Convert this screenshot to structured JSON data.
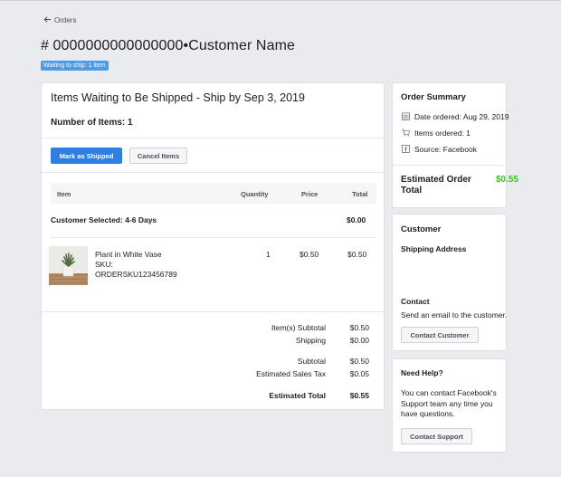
{
  "nav": {
    "back_label": "Orders"
  },
  "header": {
    "title": "# 0000000000000000•Customer Name",
    "status_badge": "Waiting to ship: 1 item"
  },
  "main": {
    "heading": "Items Waiting to Be Shipped - Ship by Sep 3, 2019",
    "items_count_label": "Number of Items: 1",
    "mark_shipped_label": "Mark as Shipped",
    "cancel_items_label": "Cancel Items",
    "table": {
      "columns": {
        "item": "Item",
        "quantity": "Quantity",
        "price": "Price",
        "total": "Total"
      },
      "group": {
        "label": "Customer Selected:  4-6 Days",
        "total": "$0.00"
      },
      "rows": [
        {
          "name": "Plant in White Vase",
          "sku_label": "SKU:",
          "sku": "ORDERSKU123456789",
          "quantity": "1",
          "price": "$0.50",
          "total": "$0.50"
        }
      ]
    },
    "totals": {
      "items_subtotal_label": "Item(s) Subtotal",
      "items_subtotal": "$0.50",
      "shipping_label": "Shipping",
      "shipping": "$0.00",
      "subtotal_label": "Subtotal",
      "subtotal": "$0.50",
      "tax_label": "Estimated Sales Tax",
      "tax": "$0.05",
      "total_label": "Estimated Total",
      "total": "$0.55"
    }
  },
  "summary": {
    "title": "Order Summary",
    "date_ordered": "Date ordered: Aug 29, 2019",
    "items_ordered": "Items ordered: 1",
    "source": "Source: Facebook",
    "estimated_total_label": "Estimated Order Total",
    "estimated_total": "$0.55"
  },
  "customer": {
    "title": "Customer",
    "shipping_address_label": "Shipping Address",
    "contact_label": "Contact",
    "contact_text": "Send an email to the customer.",
    "contact_button": "Contact Customer"
  },
  "help": {
    "title": "Need Help?",
    "text": "You can contact Facebook's Support team any time you have questions.",
    "button": "Contact Support"
  },
  "colors": {
    "accent": "#2e7ee6",
    "badge": "#4b9be8",
    "positive": "#42b72a",
    "background": "#e9ebee"
  },
  "icons": {
    "back": "arrow-left-icon",
    "date": "calendar-icon",
    "items": "cart-icon",
    "source": "facebook-icon"
  }
}
